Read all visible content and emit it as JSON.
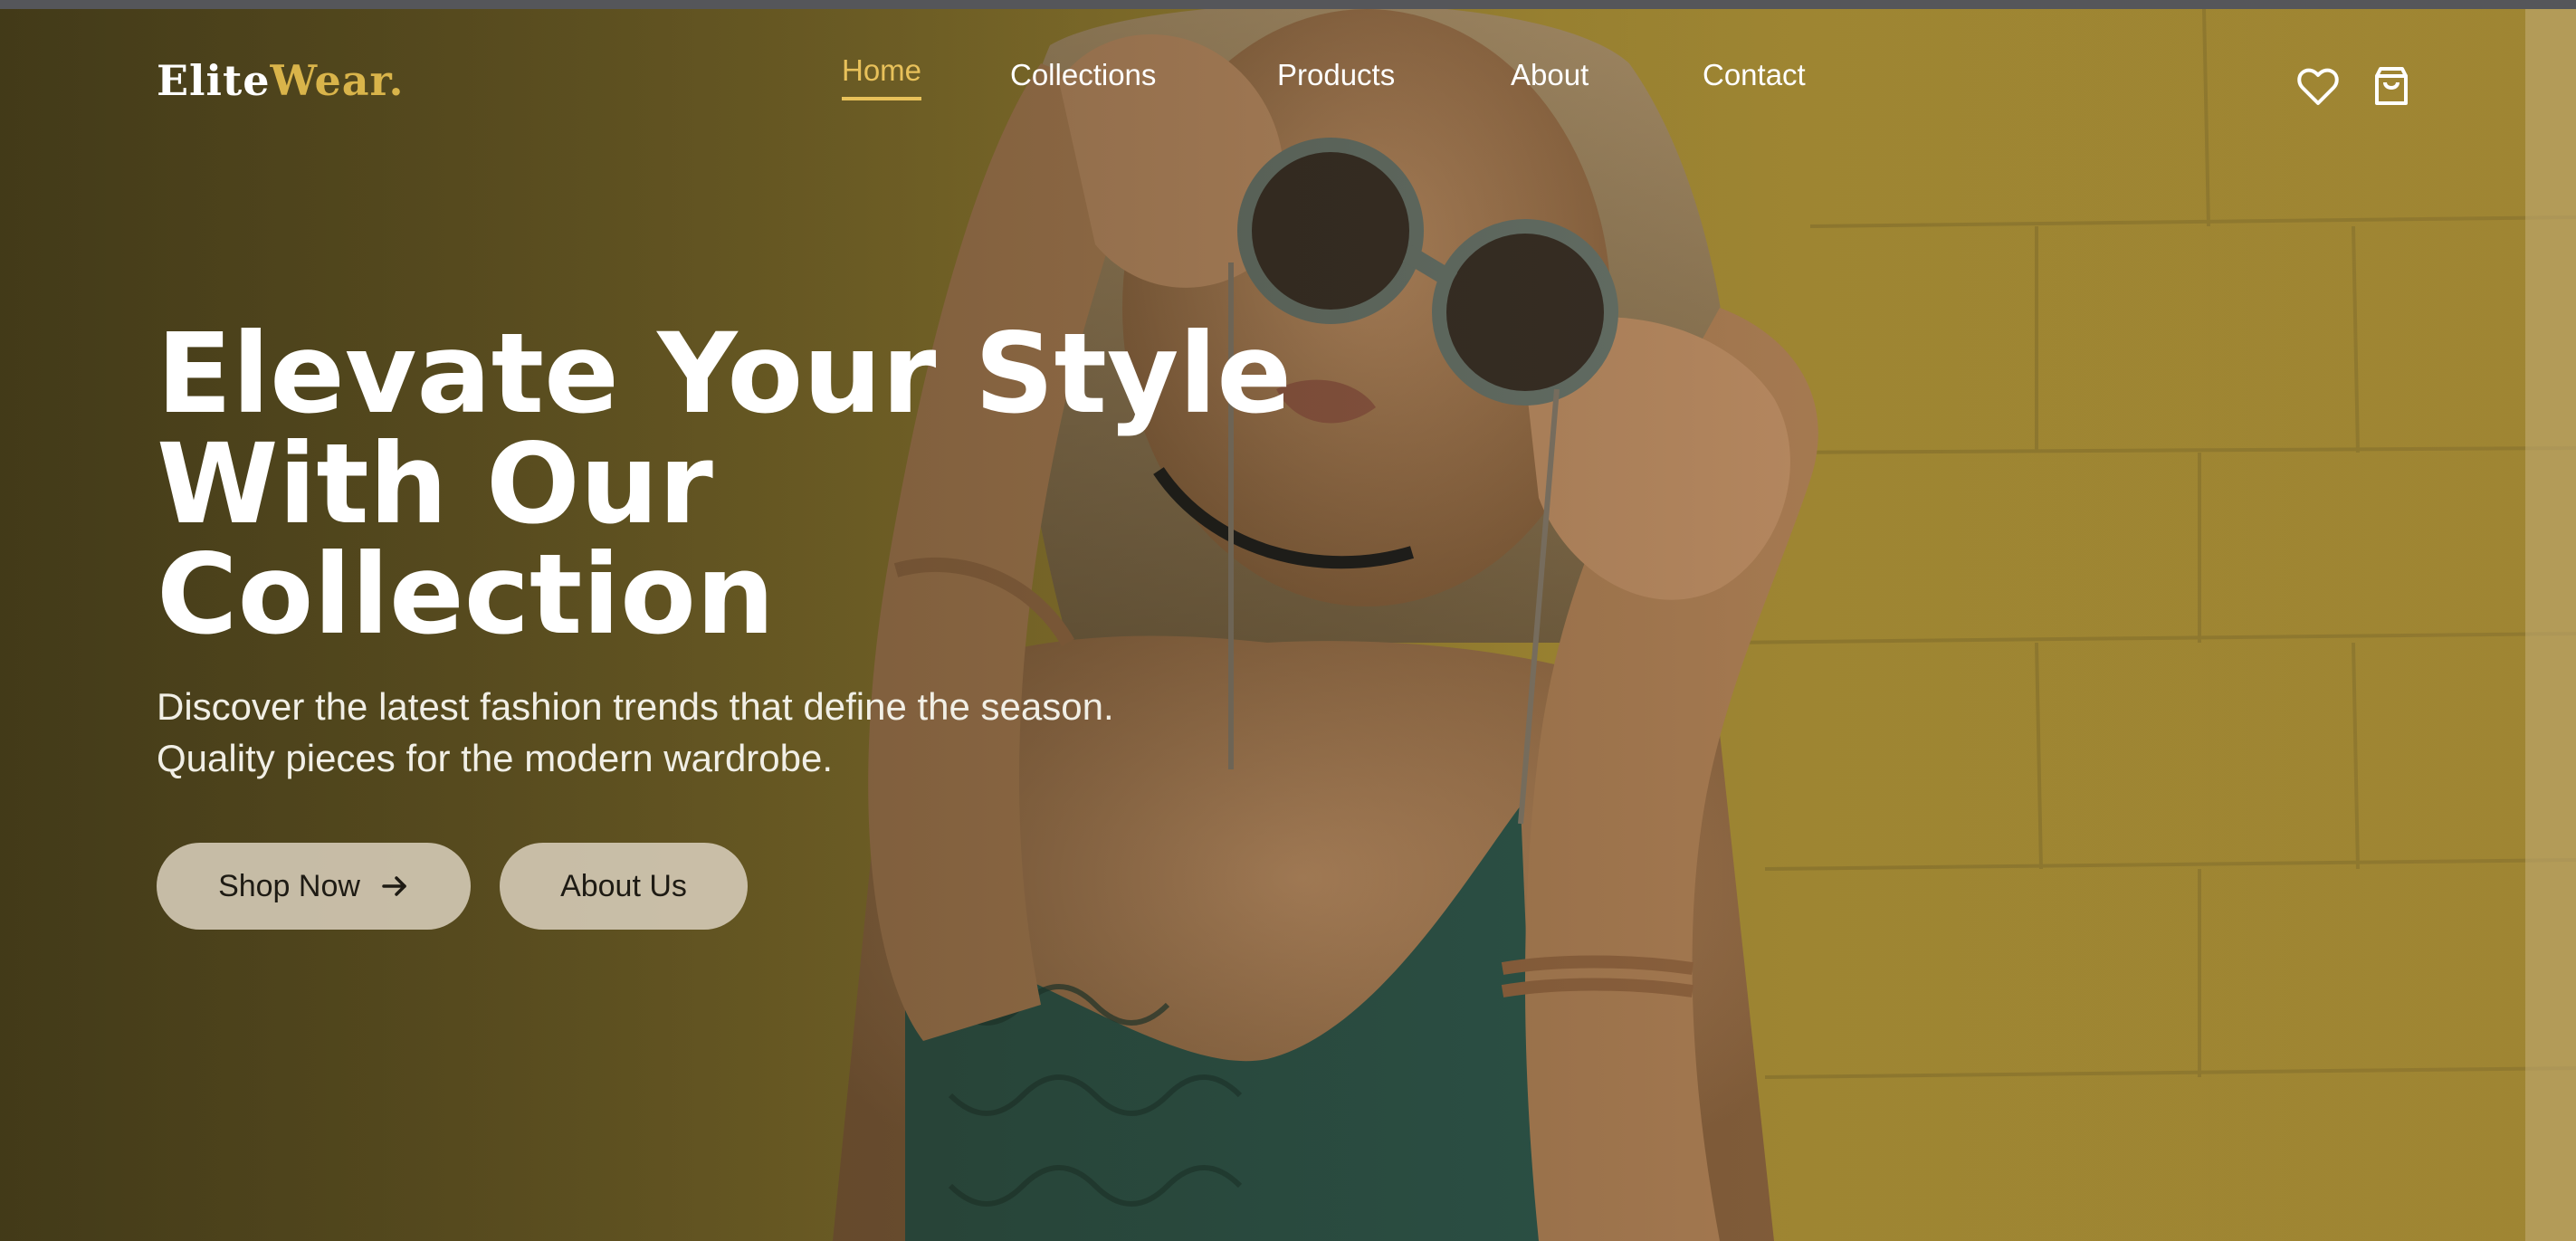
{
  "brand": {
    "name_part1": "Elite",
    "name_part2": "Wear",
    "name_dot": ".",
    "accent_color": "#d9b44a"
  },
  "nav": {
    "items": [
      {
        "label": "Home",
        "active": true
      },
      {
        "label": "Collections",
        "active": false
      },
      {
        "label": "Products",
        "active": false
      },
      {
        "label": "About",
        "active": false
      },
      {
        "label": "Contact",
        "active": false
      }
    ],
    "active_color": "#e8c15a",
    "icons": [
      "heart-icon",
      "shopping-bag-icon"
    ]
  },
  "hero": {
    "headline_lines": [
      "Elevate Your Style",
      "With Our",
      "Collection"
    ],
    "subtext_lines": [
      "Discover the latest fashion trends that define the season.",
      "Quality pieces for the modern wardrobe."
    ],
    "primary_button": {
      "label": "Shop Now",
      "icon": "arrow-right-icon"
    },
    "secondary_button": {
      "label": "About Us"
    }
  }
}
